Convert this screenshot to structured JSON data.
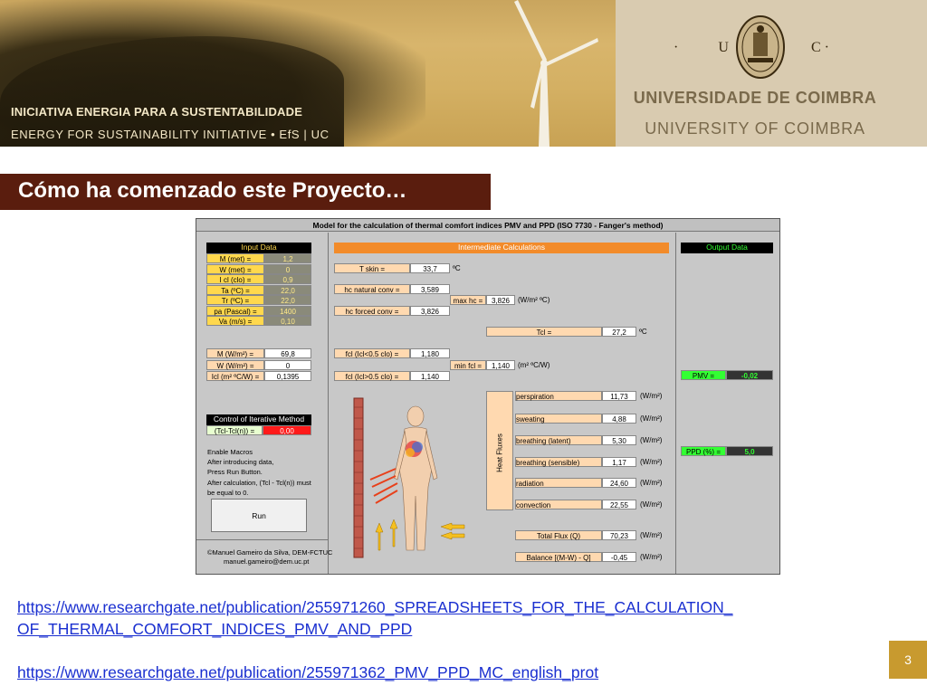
{
  "banner": {
    "line1": "INICIATIVA ENERGIA  PARA  A  SUSTENTABILIDADE",
    "line2": "ENERGY  FOR  SUSTAINABILITY  INITIATIVE •    EfS | UC",
    "uc_left": "· U",
    "uc_right": "C ·",
    "university_pt": "UNIVERSIDADE  DE  COIMBRA",
    "university_en": "UNIVERSITY  OF  COIMBRA"
  },
  "slide": {
    "title": "Cómo ha comenzado este Proyecto…",
    "page_number": "3"
  },
  "sheet": {
    "header": "Model for the calculation of thermal comfort indices PMV and PPD  (ISO 7730 - Fanger's method)",
    "input_header": "Input Data",
    "inputs": [
      {
        "label": "M (met) =",
        "value": "1,2"
      },
      {
        "label": "W (met) =",
        "value": "0"
      },
      {
        "label": "I cl (clo) =",
        "value": "0,9"
      },
      {
        "label": "Ta (ºC) =",
        "value": "22,0"
      },
      {
        "label": "Tr (ºC) =",
        "value": "22,0"
      },
      {
        "label": "pa (Pascal) =",
        "value": "1400"
      },
      {
        "label": "Va (m/s) =",
        "value": "0,10"
      }
    ],
    "derived": [
      {
        "label": "M (W/m²) =",
        "value": "69,8"
      },
      {
        "label": "W (W/m²) =",
        "value": "0"
      },
      {
        "label": "Icl (m² ºC/W) =",
        "value": "0,1395"
      }
    ],
    "control_header": "Control of Iterative Method",
    "control_label": "(Tcl-Tcl(n)) =",
    "control_value": "0,00",
    "notes": [
      "Enable Macros",
      "After introducing data,",
      "Press Run Button.",
      "After calculation, (Tcl - Tcl(n)) must",
      "be equal to 0."
    ],
    "run_label": "Run",
    "credit1": "©Manuel Gameiro da Silva, DEM-FCTUC",
    "credit2": "manuel.gameiro@dem.uc.pt",
    "intermediate_header": "Intermediate Calculations",
    "t_skin": {
      "label": "T skin =",
      "value": "33,7",
      "unit": "ºC"
    },
    "hc_natural": {
      "label": "hc natural conv =",
      "value": "3,589"
    },
    "max_hc": {
      "label": "max hc =",
      "value": "3,826",
      "unit": "(W/m² ºC)"
    },
    "hc_forced": {
      "label": "hc forced conv =",
      "value": "3,826"
    },
    "tcl": {
      "label": "Tcl =",
      "value": "27,2",
      "unit": "ºC"
    },
    "fcl_low": {
      "label": "fcl (Icl<0.5 clo) =",
      "value": "1,180"
    },
    "min_fcl": {
      "label": "min fcl =",
      "value": "1,140",
      "unit": "(m² ºC/W)"
    },
    "fcl_high": {
      "label": "fcl (Icl>0.5 clo) =",
      "value": "1,140"
    },
    "heat_fluxes_label": "Heat Fluxes",
    "fluxes": [
      {
        "label": "perspiration",
        "value": "11,73",
        "unit": "(W/m²)"
      },
      {
        "label": "sweating",
        "value": "4,88",
        "unit": "(W/m²)"
      },
      {
        "label": "breathing (latent)",
        "value": "5,30",
        "unit": "(W/m²)"
      },
      {
        "label": "breathing (sensible)",
        "value": "1,17",
        "unit": "(W/m²)"
      },
      {
        "label": "radiation",
        "value": "24,60",
        "unit": "(W/m²)"
      },
      {
        "label": "convection",
        "value": "22,55",
        "unit": "(W/m²)"
      }
    ],
    "total_flux": {
      "label": "Total Flux (Q)",
      "value": "70,23",
      "unit": "(W/m²)"
    },
    "balance": {
      "label": "Balance [(M-W) - Q]",
      "value": "-0,45",
      "unit": "(W/m²)"
    },
    "output_header": "Output Data",
    "pmv": {
      "label": "PMV  =",
      "value": "-0,02"
    },
    "ppd": {
      "label": "PPD (%) =",
      "value": "5,0"
    }
  },
  "links": {
    "link1_line1": "https://www.researchgate.net/publication/255971260_SPREADSHEETS_FOR_THE_CALCULATION_",
    "link1_line2": "OF_THERMAL_COMFORT_INDICES_PMV_AND_PPD",
    "link2": "https://www.researchgate.net/publication/255971362_PMV_PPD_MC_english_prot"
  },
  "colors": {
    "title_bg": "#5a1d0e",
    "banner_gold": "#d4b063",
    "page_box": "#c89a2f",
    "link": "#1a2fd0"
  }
}
